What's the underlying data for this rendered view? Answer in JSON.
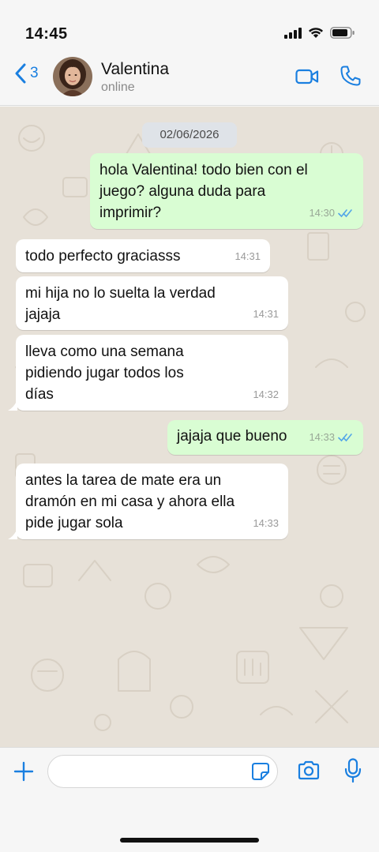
{
  "status_bar": {
    "time": "14:45"
  },
  "header": {
    "back_count": "3",
    "contact_name": "Valentina",
    "contact_status": "online"
  },
  "chat": {
    "date_chip": "02/06/2026",
    "messages": [
      {
        "direction": "out",
        "lines": [
          "hola Valentina! todo bien con el",
          "juego? alguna duda para",
          "imprimir?"
        ],
        "time": "14:30",
        "read": true
      },
      {
        "direction": "in",
        "lines": [
          "todo perfecto graciasss"
        ],
        "time": "14:31"
      },
      {
        "direction": "in",
        "lines": [
          "mi hija no lo suelta la verdad",
          "jajaja"
        ],
        "time": "14:31"
      },
      {
        "direction": "in",
        "lines": [
          "lleva como una semana",
          "pidiendo jugar todos los",
          "días"
        ],
        "time": "14:32"
      },
      {
        "direction": "out",
        "lines": [
          "jajaja que bueno"
        ],
        "time": "14:33",
        "read": true
      },
      {
        "direction": "in",
        "lines": [
          "antes la tarea de mate era un",
          "dramón en mi casa y ahora ella",
          "pide jugar sola"
        ],
        "time": "14:33"
      }
    ]
  },
  "input": {
    "placeholder": ""
  },
  "colors": {
    "accent": "#1a7fe0",
    "outgoing_bubble": "#d9fdd3",
    "incoming_bubble": "#ffffff",
    "chat_background": "#e7e1d8",
    "read_ticks": "#53a6e8"
  },
  "icons": [
    "back-chevron-icon",
    "video-camera-icon",
    "phone-icon",
    "plus-icon",
    "sticker-icon",
    "camera-icon",
    "microphone-icon",
    "signal-icon",
    "wifi-icon",
    "battery-icon",
    "double-check-icon"
  ]
}
